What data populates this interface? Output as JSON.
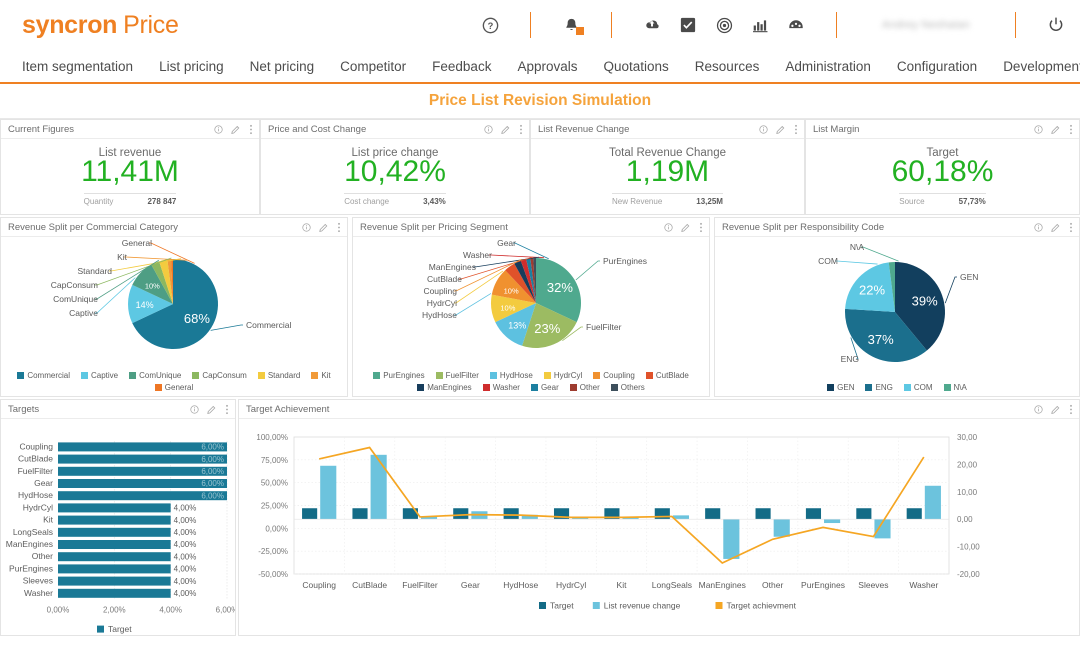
{
  "header": {
    "logo_bold": "syncron",
    "logo_light": "Price",
    "username": "Andrey Neshatan",
    "icons": [
      "help-icon",
      "notifications-icon",
      "cloud-upload-icon",
      "checkbox-icon",
      "target-icon",
      "bar-chart-icon",
      "dashboard-icon",
      "power-icon"
    ]
  },
  "nav": {
    "items": [
      {
        "label": "Item segmentation"
      },
      {
        "label": "List pricing"
      },
      {
        "label": "Net pricing"
      },
      {
        "label": "Competitor"
      },
      {
        "label": "Feedback"
      },
      {
        "label": "Approvals"
      },
      {
        "label": "Quotations"
      },
      {
        "label": "Resources"
      },
      {
        "label": "Administration"
      },
      {
        "label": "Configuration"
      },
      {
        "label": "Development"
      }
    ]
  },
  "page": {
    "title": "Price List Revision Simulation",
    "title_color": "#f5a33c"
  },
  "kpis": [
    {
      "panel_title": "Current Figures",
      "label": "List revenue",
      "value": "11,41M",
      "sub_key": "Quantity",
      "sub_value": "278 847",
      "value_color": "#22b122"
    },
    {
      "panel_title": "Price and Cost Change",
      "label": "List price change",
      "value": "10,42%",
      "sub_key": "Cost change",
      "sub_value": "3,43%",
      "value_color": "#22b122"
    },
    {
      "panel_title": "List Revenue Change",
      "label": "Total Revenue Change",
      "value": "1,19M",
      "sub_key": "New Revenue",
      "sub_value": "13,25M",
      "value_color": "#22b122"
    },
    {
      "panel_title": "List Margin",
      "label": "Target",
      "value": "60,18%",
      "sub_key": "Source",
      "sub_value": "57,73%",
      "value_color": "#22b122"
    }
  ],
  "chart_data": [
    {
      "id": "pie_commercial",
      "type": "pie",
      "title": "Revenue Split per Commercial Category",
      "categories": [
        "Commercial",
        "Captive",
        "ComUnique",
        "CapConsum",
        "Standard",
        "Kit",
        "General"
      ],
      "values": [
        68,
        14,
        10,
        3,
        3,
        1.3,
        0.7
      ],
      "labels": [
        "68%",
        "14%",
        "10%",
        "",
        "",
        "",
        ""
      ],
      "colors": [
        "#1a7996",
        "#5dc8e3",
        "#4e9e84",
        "#8cb860",
        "#f3cb3f",
        "#f19a38",
        "#ee7624"
      ],
      "legend_position": "bottom"
    },
    {
      "id": "pie_pricing_segment",
      "type": "pie",
      "title": "Revenue Split per Pricing Segment",
      "categories": [
        "PurEngines",
        "FuelFilter",
        "HydHose",
        "HydrCyl",
        "Coupling",
        "CutBlade",
        "ManEngines",
        "Washer",
        "Gear",
        "Other",
        "Others"
      ],
      "values": [
        32,
        23,
        13,
        10,
        10,
        4,
        2.5,
        2,
        1.5,
        1,
        1
      ],
      "labels": [
        "32%",
        "23%",
        "13%",
        "10%",
        "10%",
        "",
        "",
        "",
        "",
        "",
        ""
      ],
      "colors": [
        "#4fa98e",
        "#9cbb62",
        "#5dc1e0",
        "#f3cb3f",
        "#f0912f",
        "#e0522a",
        "#173d5c",
        "#cf2d2d",
        "#1c7fa0",
        "#9e3c2f",
        "#3d4f5c"
      ],
      "legend_position": "bottom"
    },
    {
      "id": "pie_responsibility_code",
      "type": "pie",
      "title": "Revenue Split per Responsibility Code",
      "categories": [
        "GEN",
        "ENG",
        "COM",
        "N\\A"
      ],
      "values": [
        39,
        37,
        22,
        2
      ],
      "labels": [
        "39%",
        "37%",
        "22%",
        ""
      ],
      "colors": [
        "#123f5e",
        "#1b6f8d",
        "#5dc8e3",
        "#4fa98e"
      ],
      "legend_position": "bottom"
    },
    {
      "id": "targets_bar",
      "type": "bar",
      "orientation": "horizontal",
      "title": "Targets",
      "categories": [
        "Coupling",
        "CutBlade",
        "FuelFilter",
        "Gear",
        "HydHose",
        "HydrCyl",
        "Kit",
        "LongSeals",
        "ManEngines",
        "Other",
        "PurEngines",
        "Sleeves",
        "Washer"
      ],
      "values": [
        6.0,
        6.0,
        6.0,
        6.0,
        6.0,
        4.0,
        4.0,
        4.0,
        4.0,
        4.0,
        4.0,
        4.0,
        4.0
      ],
      "value_labels": [
        "6,00%",
        "6,00%",
        "6,00%",
        "6,00%",
        "6,00%",
        "4,00%",
        "4,00%",
        "4,00%",
        "4,00%",
        "4,00%",
        "4,00%",
        "4,00%",
        "4,00%"
      ],
      "xticks": [
        "0,00%",
        "2,00%",
        "4,00%",
        "6,00%"
      ],
      "xlim": [
        0,
        6
      ],
      "legend": [
        {
          "name": "Target",
          "color": "#1a7996"
        }
      ],
      "series_color": "#1a7996",
      "legend_position": "bottom"
    },
    {
      "id": "target_achievement",
      "type": "bar",
      "title": "Target Achievement",
      "categories": [
        "Coupling",
        "CutBlade",
        "FuelFilter",
        "Gear",
        "HydHose",
        "HydrCyl",
        "Kit",
        "LongSeals",
        "ManEngines",
        "Other",
        "PurEngines",
        "Sleeves",
        "Washer"
      ],
      "series": [
        {
          "name": "Target",
          "color": "#136b86",
          "type": "bar",
          "axis": "right",
          "values": [
            4,
            4,
            4,
            4,
            4,
            4,
            4,
            4,
            4,
            4,
            4,
            4,
            4
          ]
        },
        {
          "name": "List revenue change",
          "color": "#6cc3dd",
          "type": "bar",
          "axis": "right",
          "values": [
            19.5,
            23.5,
            0.6,
            2.9,
            1.6,
            0,
            0,
            1.4,
            -14.5,
            -6.4,
            -1.4,
            -7.0,
            12.2
          ]
        },
        {
          "name": "Target achievment",
          "color": "#f5a623",
          "type": "line",
          "axis": "left",
          "values": [
            76.0,
            88.5,
            12.5,
            15.0,
            14.5,
            12.0,
            12.0,
            13.0,
            -38.0,
            -12.0,
            1.0,
            -9.0,
            78.0
          ]
        }
      ],
      "left_yticks": [
        "100,00%",
        "75,00%",
        "50,00%",
        "25,00%",
        "0,00%",
        "-25,00%",
        "-50,00%"
      ],
      "left_ylim": [
        -50,
        100
      ],
      "right_yticks": [
        "30,00",
        "20,00",
        "10,00",
        "0,00",
        "-10,00",
        "-20,00"
      ],
      "right_ylim": [
        -20,
        30
      ],
      "legend_position": "bottom"
    }
  ],
  "panel_actions": {
    "info": "info-icon",
    "edit": "edit-icon",
    "more": "more-options-icon"
  }
}
